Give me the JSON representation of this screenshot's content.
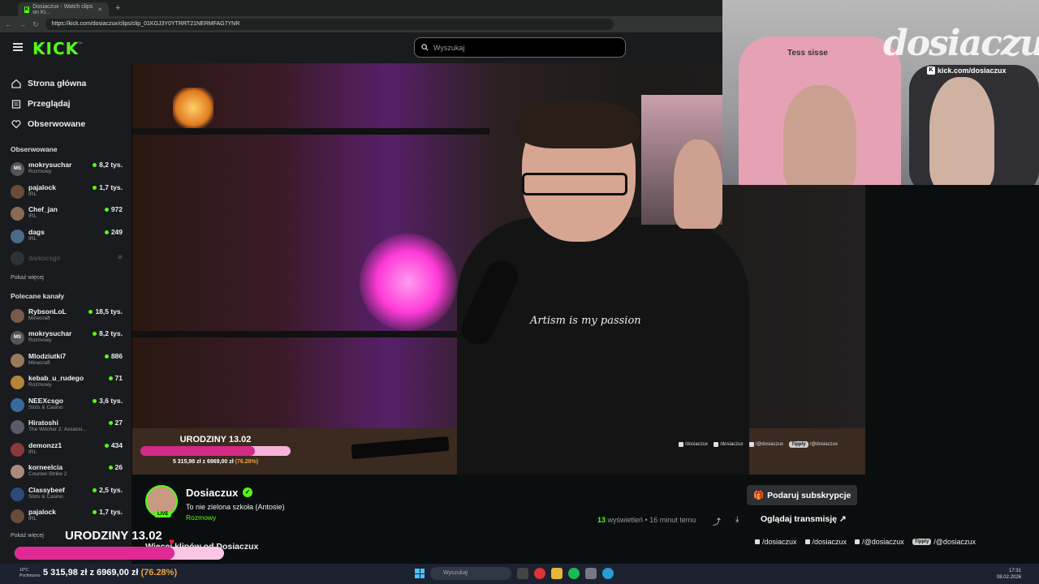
{
  "browser": {
    "tab_title": "Dosiaczux - Watch clips on Ki...",
    "url": "https://kick.com/dosiaczux/clips/clip_01KGJ3Y0YTRRT21NERMFAG7YNR"
  },
  "header": {
    "logo": "KICK",
    "logo_beta": "BETA",
    "search_placeholder": "Wyszukaj"
  },
  "sidebar": {
    "nav": [
      {
        "label": "Strona główna",
        "icon": "home-icon"
      },
      {
        "label": "Przeglądaj",
        "icon": "browse-icon"
      },
      {
        "label": "Obserwowane",
        "icon": "heart-icon"
      }
    ],
    "followed_title": "Obserwowane",
    "followed": [
      {
        "name": "mokrysuchar",
        "category": "Rozmowy",
        "viewers": "8,2 tys.",
        "avatar": "MS"
      },
      {
        "name": "pajalock",
        "category": "IRL",
        "viewers": "1,7 tys.",
        "avatar": ""
      },
      {
        "name": "Chef_jan",
        "category": "IRL",
        "viewers": "972",
        "avatar": ""
      },
      {
        "name": "dags",
        "category": "IRL",
        "viewers": "249",
        "avatar": ""
      }
    ],
    "offline": {
      "name": "darkocsgo"
    },
    "show_more": "Pokaż więcej",
    "recommended_title": "Polecane kanały",
    "recommended": [
      {
        "name": "RybsonLoL",
        "category": "Minecraft",
        "viewers": "18,5 tys.",
        "avatar": ""
      },
      {
        "name": "mokrysuchar",
        "category": "Rozmowy",
        "viewers": "8,2 tys.",
        "avatar": "MS"
      },
      {
        "name": "Mlodziutki7",
        "category": "Minecraft",
        "viewers": "886",
        "avatar": ""
      },
      {
        "name": "kebab_u_rudego",
        "category": "Rozmowy",
        "viewers": "71",
        "avatar": ""
      },
      {
        "name": "NEEXcsgo",
        "category": "Slots & Casino",
        "viewers": "3,6 tys.",
        "avatar": ""
      },
      {
        "name": "Hiratoshi",
        "category": "The Witcher 2: Assassi...",
        "viewers": "27",
        "avatar": ""
      },
      {
        "name": "demonzz1",
        "category": "IRL",
        "viewers": "434",
        "avatar": ""
      },
      {
        "name": "korneelcia",
        "category": "Counter-Strike 2",
        "viewers": "26",
        "avatar": ""
      },
      {
        "name": "Classybeef",
        "category": "Slots & Casino",
        "viewers": "2,5 tys.",
        "avatar": ""
      },
      {
        "name": "pajalock",
        "category": "IRL",
        "viewers": "1,7 tys.",
        "avatar": ""
      }
    ],
    "show_more_2": "Pokaż więcej"
  },
  "video": {
    "shirt_text": "Artism is my passion",
    "socials": [
      "/dosiaczux",
      "/dosiaczux",
      "/@dosiaczux",
      "/@dosiaczux"
    ],
    "tippy": "Tipply"
  },
  "goal": {
    "title": "URODZINY 13.02",
    "amount": "5 315,98 zł z 6969,00 zł",
    "percent_text": "(76.28%)",
    "fraction": 0.7628
  },
  "clip": {
    "channel": "Dosiaczux",
    "live_badge": "LIVE",
    "title": "To nie zielona szkoła (Antosie)",
    "category": "Rozmowy",
    "subscribe_label": "Podaruj subskrypcje",
    "views_count": "13",
    "views_label": "wyświetleń",
    "time_ago": "16 minut temu",
    "watch_label": "Oglądaj transmisję",
    "more_clips": "Więcej klipów od Dosiaczux"
  },
  "right_socials": [
    "/dosiaczux",
    "/dosiaczux",
    "/@dosiaczux",
    "/@dosiaczux"
  ],
  "cam": {
    "logo": "dosiaczux",
    "url": "kick.com/dosiaczux",
    "chair_text": "Tess sisse"
  },
  "taskbar": {
    "search_placeholder": "Wyszukaj",
    "weather": "10°C",
    "weather_sub": "Pochmurno",
    "time": "17:31",
    "date": "08.02.2026"
  },
  "colors": {
    "accent": "#53fc18",
    "goal_fill": "#e02995",
    "goal_track": "#fbc6e4",
    "percent": "#f2a33a"
  }
}
